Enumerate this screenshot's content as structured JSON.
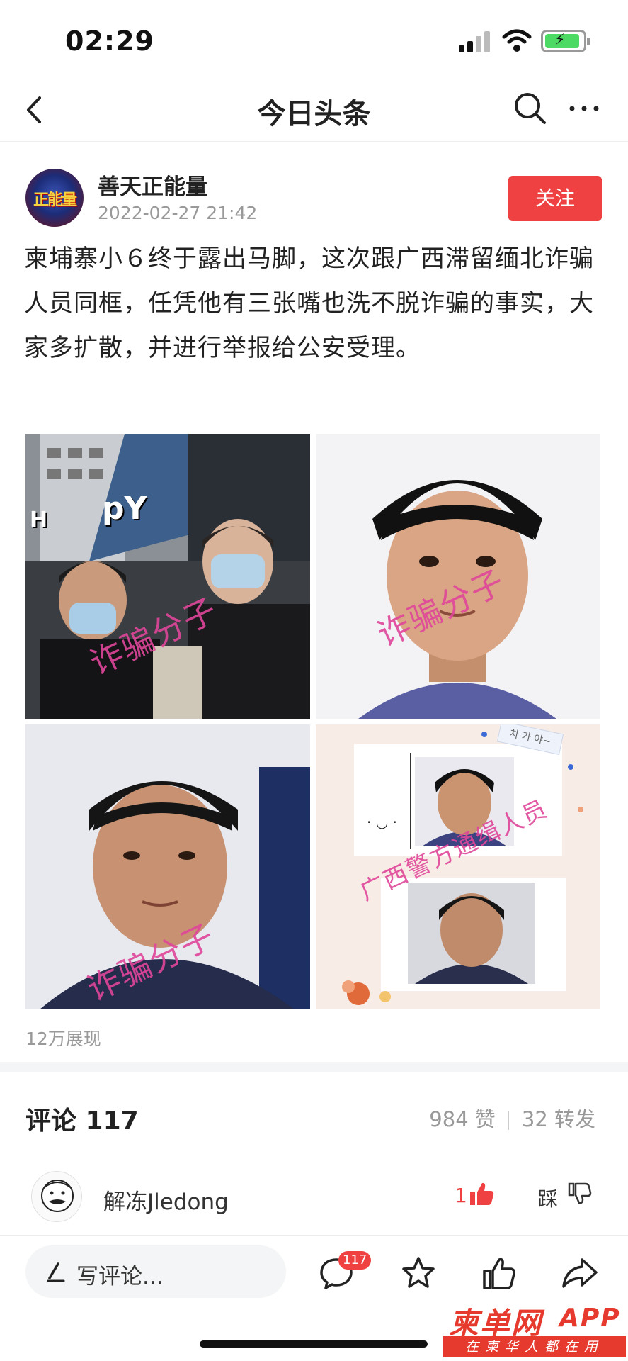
{
  "status_bar": {
    "time": "02:29"
  },
  "nav": {
    "title": "今日头条"
  },
  "author": {
    "avatar_text": "正能量",
    "name": "善天正能量",
    "timestamp": "2022-02-27 21:42",
    "follow_label": "关注"
  },
  "post": {
    "text": "柬埔寨小６终于露出马脚，这次跟广西滞留缅北诈骗人员同框，任凭他有三张嘴也洗不脱诈骗的事实，大家多扩散，并进行举报给公安受理。",
    "images": [
      {
        "watermark": "诈骗分子",
        "sign_text": "pY"
      },
      {
        "watermark": "诈骗分子"
      },
      {
        "watermark": "诈骗分子"
      },
      {
        "watermark": "广西警方通缉人员",
        "tag_text": "차 가 야~"
      }
    ],
    "views": "12万展现"
  },
  "comments": {
    "title": "评论 117",
    "likes": "984 赞",
    "shares": "32 转发",
    "items": [
      {
        "user": "解冻Jledong",
        "like_count": "1",
        "step_label": "踩"
      }
    ]
  },
  "bottom_bar": {
    "placeholder": "写评论...",
    "comment_badge": "117"
  },
  "watermark_logo": {
    "name": "柬单网",
    "app": "APP",
    "slogan": "在柬华人都在用"
  },
  "colors": {
    "accent": "#f04142",
    "watermark_pink": "#e0469a",
    "logo_red": "#e63a2e"
  }
}
